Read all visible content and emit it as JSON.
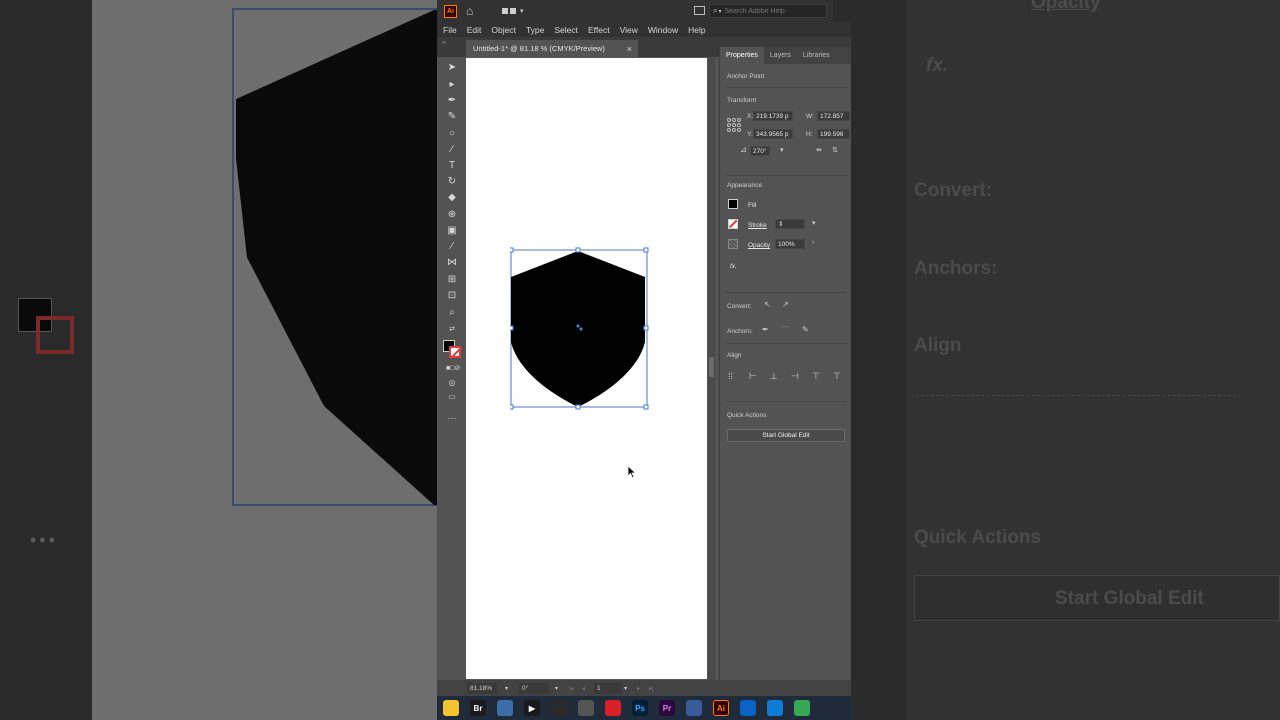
{
  "background": {
    "right_panel_ghost": {
      "opacity": "Opacity",
      "fx": "fx.",
      "convert": "Convert:",
      "anchors": "Anchors:",
      "align": "Align",
      "quick_actions": "Quick Actions",
      "start_global_edit": "Start Global Edit"
    }
  },
  "titlebar": {
    "logo": "Ai",
    "search_placeholder": "Search Adobe Help"
  },
  "menu": [
    "File",
    "Edit",
    "Object",
    "Type",
    "Select",
    "Effect",
    "View",
    "Window",
    "Help"
  ],
  "document_tab": {
    "title": "Untitled-1* @ 81.18 % (CMYK/Preview)",
    "close": "×"
  },
  "tools": [
    "selection-tool",
    "direct-selection-tool",
    "pen-tool",
    "curvature-tool",
    "ellipse-tool",
    "paintbrush-tool",
    "type-tool",
    "rotate-tool",
    "eraser-tool",
    "shape-builder-tool",
    "gradient-tool",
    "eyedropper-tool",
    "blend-tool",
    "symbol-sprayer-tool",
    "artboard-tool",
    "zoom-tool",
    "more-tools"
  ],
  "fill_color": "#000000",
  "stroke_color": "none",
  "panel": {
    "tabs": [
      "Properties",
      "Layers",
      "Libraries"
    ],
    "active_tab": "Properties",
    "anchor_point": "Anchor Point",
    "transform": {
      "title": "Transform",
      "x_label": "X:",
      "x_value": "219.1739 p",
      "w_label": "W:",
      "w_value": "172.857",
      "y_label": "Y:",
      "y_value": "343.9565 p",
      "h_label": "H:",
      "h_value": "199.596",
      "angle": "270°"
    },
    "appearance": {
      "title": "Appearance",
      "fill": "Fill",
      "stroke": "Stroke",
      "opacity_label": "Opacity",
      "opacity_value": "100%",
      "fx": "fx."
    },
    "convert": "Convert:",
    "anchors": "Anchors:",
    "align": "Align",
    "quick_actions": {
      "title": "Quick Actions",
      "start_global_edit": "Start Global Edit"
    }
  },
  "statusbar": {
    "zoom": "81.18%",
    "rotation": "0°",
    "artboard": "1"
  },
  "taskbar": [
    {
      "name": "file-explorer",
      "label": "",
      "color": "#f4c430"
    },
    {
      "name": "bridge",
      "label": "Br",
      "color": "#1a1a1a"
    },
    {
      "name": "calculator",
      "label": "",
      "color": "#3b6ea8"
    },
    {
      "name": "media-player",
      "label": "▶",
      "color": "#1a1a1a"
    },
    {
      "name": "obs",
      "label": "",
      "color": "#2a2a2a"
    },
    {
      "name": "cloud-app",
      "label": "",
      "color": "#555555"
    },
    {
      "name": "creative-cloud",
      "label": "",
      "color": "#da1f26"
    },
    {
      "name": "photoshop",
      "label": "Ps",
      "color": "#001e36"
    },
    {
      "name": "premiere",
      "label": "Pr",
      "color": "#2a0a3a"
    },
    {
      "name": "notepad",
      "label": "",
      "color": "#3a5a9a"
    },
    {
      "name": "illustrator",
      "label": "Ai",
      "color": "#330000"
    },
    {
      "name": "mail",
      "label": "",
      "color": "#0a64c8"
    },
    {
      "name": "edge",
      "label": "",
      "color": "#0c7cd5"
    },
    {
      "name": "chrome",
      "label": "",
      "color": "#34a853"
    }
  ]
}
